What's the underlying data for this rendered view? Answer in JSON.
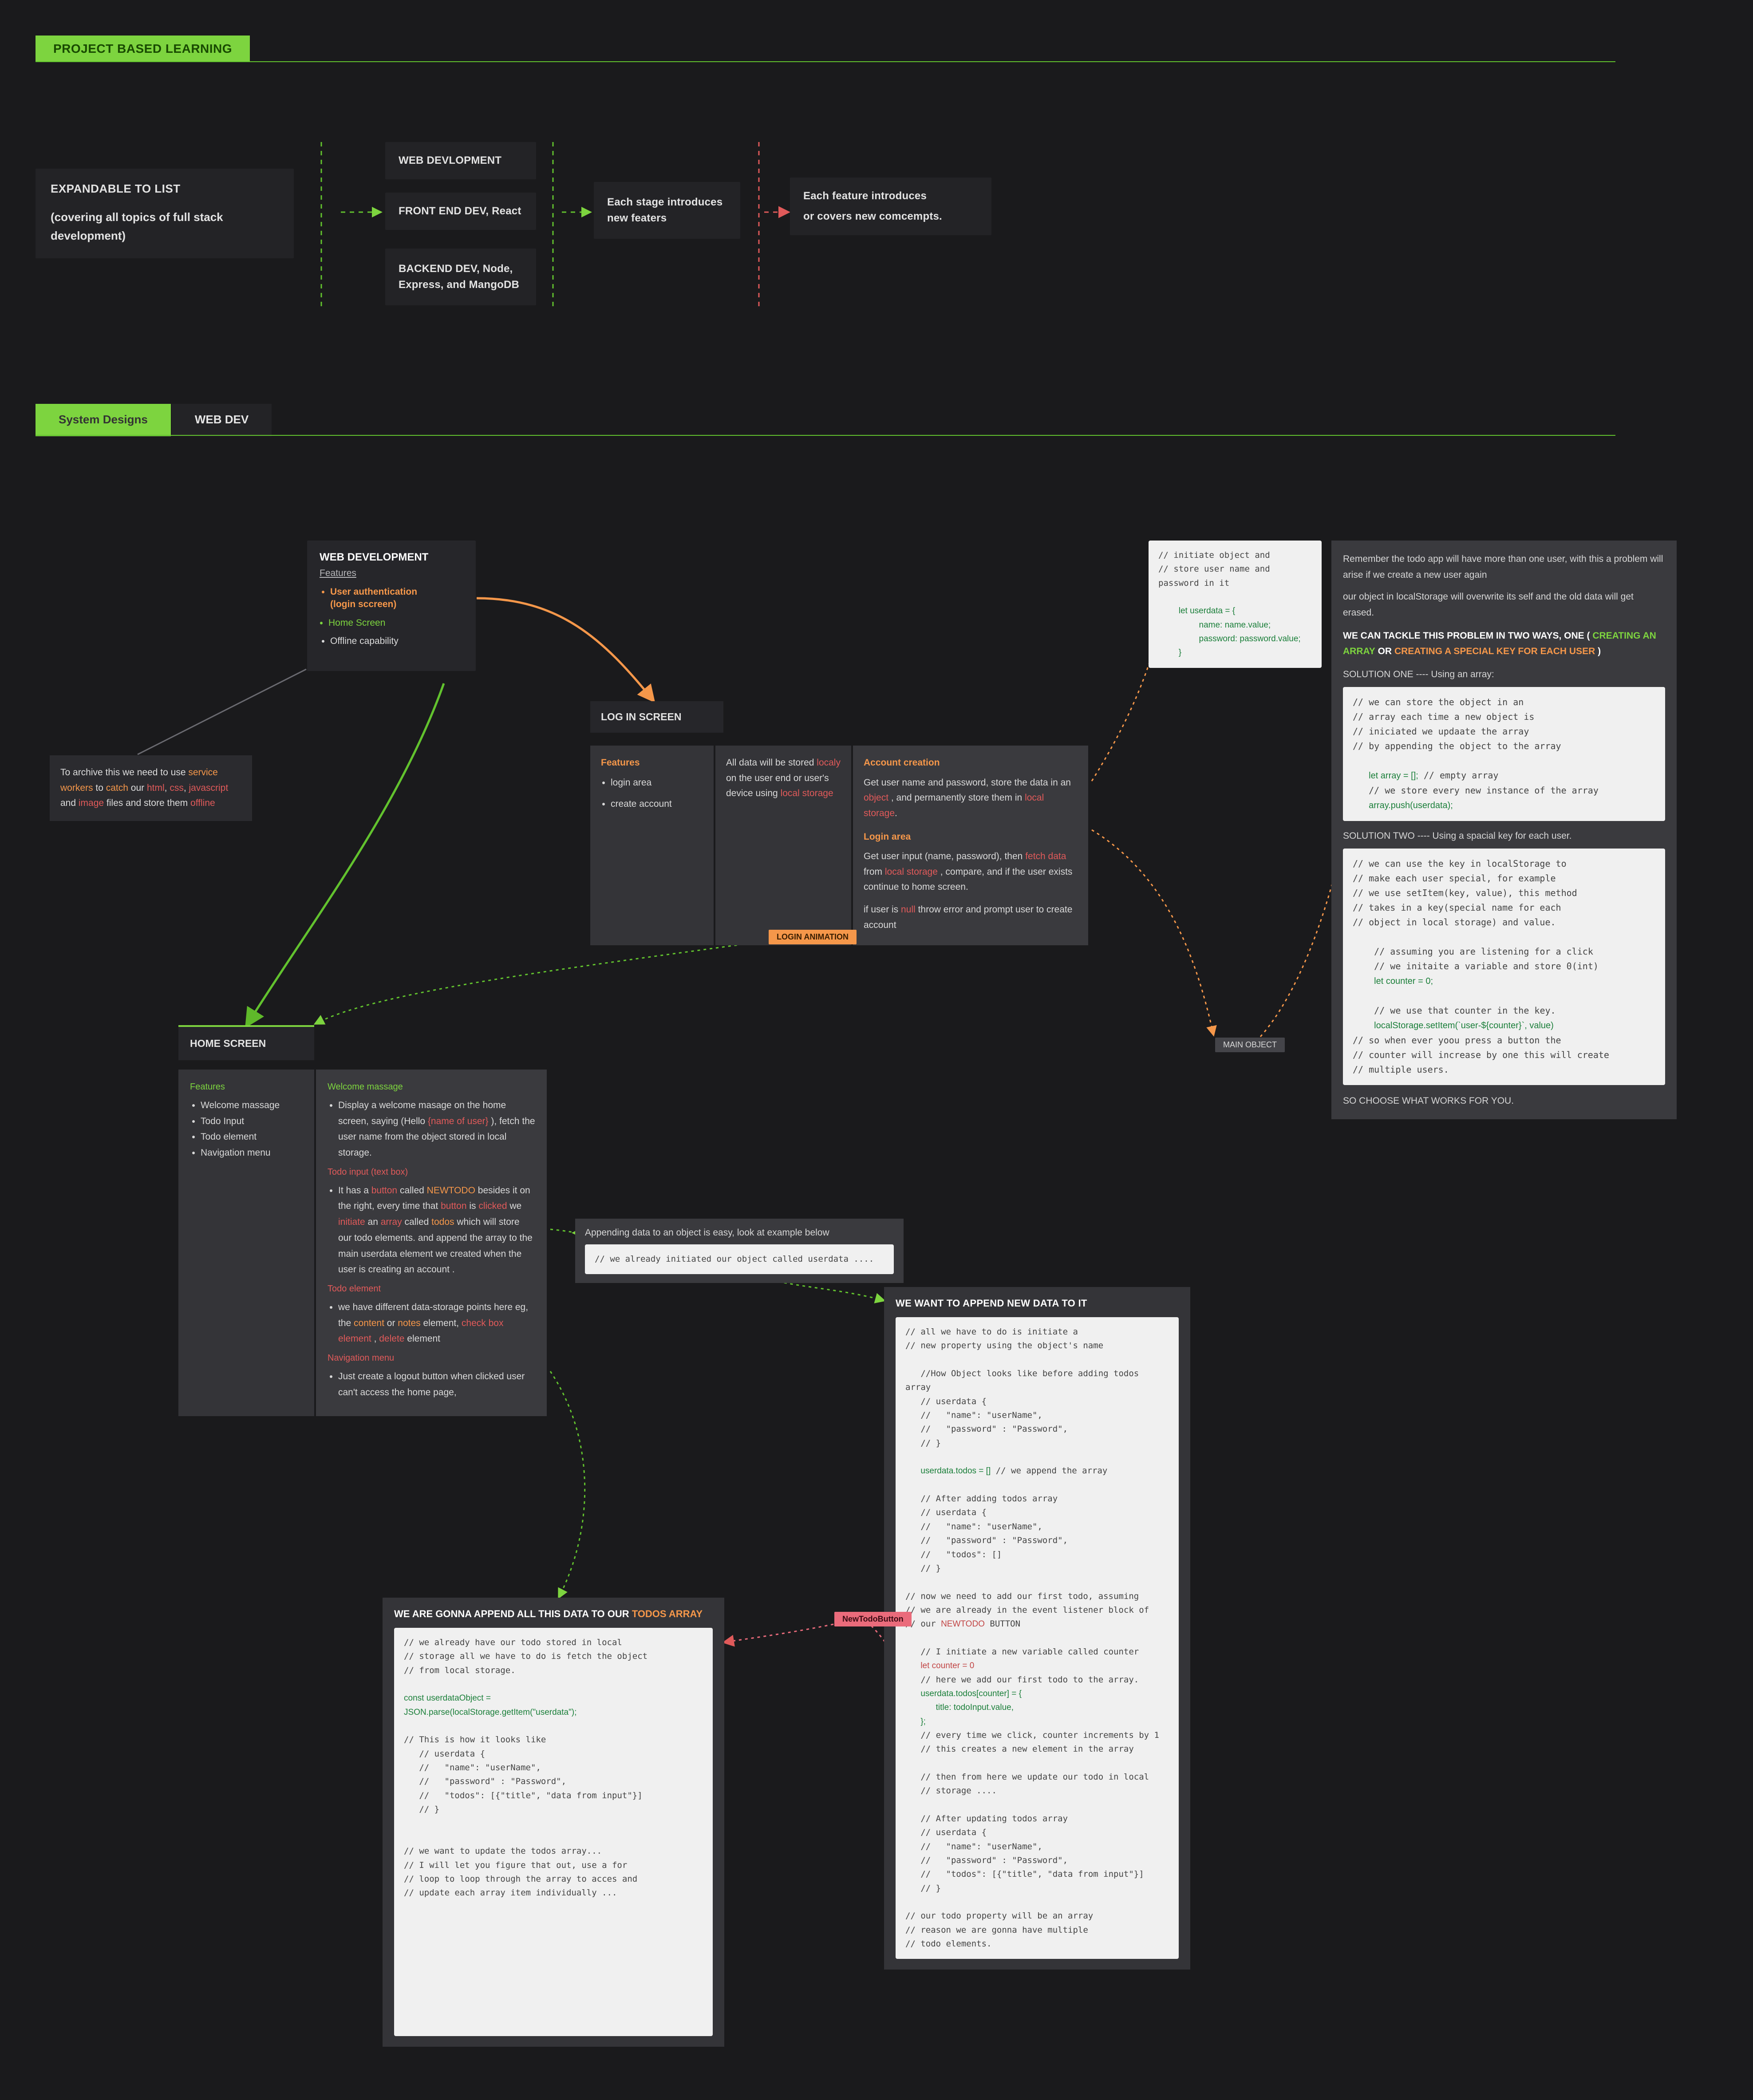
{
  "header": {
    "chip": "PROJECT BASED LEARNING"
  },
  "flow": {
    "intro_line1": "EXPANDABLE TO LIST",
    "intro_line2": "(covering all topics of full stack development)",
    "web": "WEB DEVLOPMENT",
    "front": "FRONT END DEV, React",
    "back": "BACKEND DEV, Node, Express, and MangoDB",
    "stage": "Each stage introduces new featers",
    "feat_l1": "Each feature introduces",
    "feat_l2": "or covers new comcempts."
  },
  "tabs": {
    "a": "System Designs",
    "b": "WEB DEV"
  },
  "webdev": {
    "title": "WEB DEVELOPMENT",
    "features_label": "Features",
    "f1a": "User authentication",
    "f1b": "(login sccreen)",
    "f2": "Home Screen",
    "f3": "Offline capability"
  },
  "offline": {
    "pre": "To archive this we need to use ",
    "sw": "service workers",
    "mid1": " to ",
    "catch": "catch",
    "mid2": " our ",
    "html": "html",
    "css": "css",
    "js": "javascript",
    "img": "image",
    "mid3": " files and store them ",
    "off": "offline"
  },
  "login": {
    "title": "LOG IN SCREEN",
    "c1_h": "Features",
    "c1_li1": "login area",
    "c1_li2": "create account",
    "c2_a": "All data will be stored ",
    "c2_locally": "localy",
    "c2_b": " on the user end or user's device using ",
    "c2_ls": "local storage",
    "c3_acc_h": "Account creation",
    "c3_acc_t1": "Get user name and password, store the data in an ",
    "c3_obj": "object",
    "c3_acc_t2": ", and permanently store them in ",
    "c3_ls": "local storage",
    "c3_la_h": "Login area",
    "c3_la_t1": "Get user input (name, password), then ",
    "c3_fetch": "fetch data",
    "c3_la_t2": " from ",
    "c3_la_ls": "local storage",
    "c3_la_t3": ", compare, and if the user exists continue to home screen.",
    "c3_null_a": "if user is ",
    "c3_null": "null",
    "c3_null_b": " throw error and prompt user to create account",
    "anim": "LOGIN ANIMATION"
  },
  "home": {
    "title": "HOME SCREEN",
    "c1_h": "Features",
    "c1": [
      "Welcome massage",
      "Todo Input",
      "Todo element",
      "Navigation menu"
    ],
    "wm_h": "Welcome massage",
    "wm_a": "Display a welcome masage on the home screen, saying (Hello ",
    "wm_user": "{name of user}",
    "wm_b": "), fetch the user name from the object stored in local storage.",
    "ti_h": "Todo input (text box)",
    "ti_a": "It has a ",
    "ti_btn": "button",
    "ti_b": " called ",
    "ti_new": "NEWTODO",
    "ti_c": " besides it on the right, every time that ",
    "ti_btn2": "button",
    "ti_d": " is ",
    "ti_clk": "clicked",
    "ti_e": " we ",
    "ti_init": "initiate",
    "ti_f": " an ",
    "ti_arr": "array",
    "ti_g": " called ",
    "ti_todos": "todos",
    "ti_h2": " which will store our todo elements. and append the array to the main userdata element we created when the user is creating an account .",
    "te_h": "Todo element",
    "te_a": "we have different data-storage points here eg, the ",
    "te_content": "content",
    "te_b": " or ",
    "te_notes": "notes",
    "te_c": " element, ",
    "te_check": "check box element",
    "te_d": ", ",
    "te_del": "delete",
    "te_e": " element",
    "nm_h": "Navigation menu",
    "nm_a": "Just create a logout button when clicked user can't access the home page,"
  },
  "code_init": "// initiate object and\n// store user name and password in it\n\n    <kg>let userdata = {</kg>\n        <kg>name: name.value;</kg>\n        <kg>password: password.value;</kg>\n    <kg>}</kg>",
  "mu": {
    "p1": "Remember  the todo app will have more than one user, with this a problem will arise if we create a new user again",
    "p2": "our object in localStorage will overwrite its self and the old data will get erased.",
    "p3_a": "WE CAN TACKLE THIS PROBLEM IN TWO WAYS, ONE ( ",
    "p3_g": "CREATING AN ARRAY",
    "p3_b": " OR ",
    "p3_r": "CREATING A SPECIAL KEY FOR EACH USER",
    "p3_c": " )",
    "s1h": "SOLUTION ONE ---- Using an array:",
    "s1": "// we can store the object in an\n// array each time a new object is\n// iniciated we updaate the array\n// by appending the object to the array\n\n   <kg>let array = [];</kg> // empty array\n   // we store every new instance of the array\n   <kg>array.push(userdata);</kg>",
    "s2h": "SOLUTION TWO ---- Using a spacial key for each user.",
    "s2": "// we can use the key in localStorage to\n// make each user special, for example\n// we use setItem(key, value), this method\n// takes in a key(special name for each\n// object in local storage) and value.\n\n    // assuming you are listening for a click\n    // we initaite a variable and store 0(int)\n    <kg>let counter = 0;</kg>\n\n    // we use that counter in the key.\n    <kg>localStorage.setItem(`user-${counter}`, value)</kg>\n// so when ever yoou press a button the\n// counter will increase by one this will create\n// multiple users.",
    "foot": "SO CHOOSE WHAT WORKS FOR YOU.",
    "main_obj": "MAIN OBJECT"
  },
  "append_bar": {
    "txt": "Appending data to an object is easy, look at example below",
    "code": "// we already initiated our object called userdata ...."
  },
  "append_panel": {
    "hd": "WE WANT TO APPEND NEW DATA TO IT",
    "code": "// all we have to do is initiate a\n// new property using the object's name\n\n   //How Object looks like before adding todos array\n   // userdata {\n   //   \"name\": \"userName\",\n   //   \"password\" : \"Password\",\n   // }\n\n   <kg>userdata.todos = []</kg> // we append the array\n\n   // After adding todos array\n   // userdata {\n   //   \"name\": \"userName\",\n   //   \"password\" : \"Password\",\n   //   \"todos\": []\n   // }\n\n// now we need to add our first todo, assuming\n// we are already in the event listener block of\n// our <kr>NEWTODO</kr> BUTTON\n\n   // I initiate a new variable called counter\n   <kr>let counter = 0</kr>\n   // here we add our first todo to the array.\n   <kg>userdata.todos[counter] = {</kg>\n      <kg>title: todoInput.value,</kg>\n   <kg>};</kg>\n   // every time we click, counter increments by 1\n   // this creates a new element in the array\n\n   // then from here we update our todo in local\n   // storage ....\n\n   // After updating todos array\n   // userdata {\n   //   \"name\": \"userName\",\n   //   \"password\" : \"Password\",\n   //   \"todos\": [{\"title\", \"data from input\"}]\n   // }\n\n// our todo property will be an array\n// reason we are gonna have multiple\n// todo elements."
  },
  "todos_panel": {
    "hd_a": "WE ARE GONNA APPEND ALL THIS DATA TO OUR ",
    "hd_b": "TODOS ARRAY",
    "code": "// we already have our todo stored in local\n// storage all we have to do is fetch the object\n// from local storage.\n\n<kg>const userdataObject =</kg>\n<kg>JSON.parse(localStorage.getItem(\"userdata\");</kg>\n\n// This is how it looks like\n   // userdata {\n   //   \"name\": \"userName\",\n   //   \"password\" : \"Password\",\n   //   \"todos\": [{\"title\", \"data from input\"}]\n   // }\n\n\n// we want to update the todos array...\n// I will let you figure that out, use a for\n// loop to loop through the array to acces and\n// update each array item individually ..."
  },
  "chips": {
    "new_todo": "NewTodoButton"
  }
}
